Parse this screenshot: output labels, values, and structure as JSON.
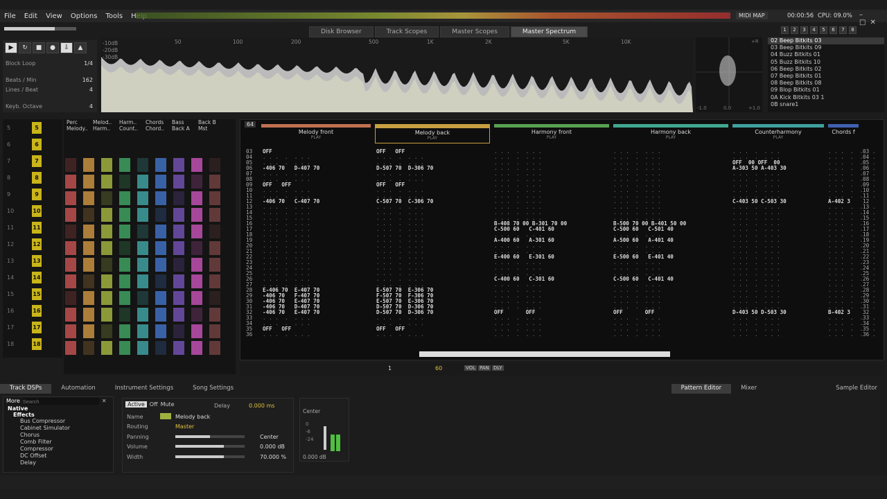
{
  "menu": [
    "File",
    "Edit",
    "View",
    "Options",
    "Tools",
    "Help"
  ],
  "status": {
    "midi_map": "MIDI MAP",
    "time": "00:00:56",
    "cpu": "CPU: 09.0%"
  },
  "top_tabs": [
    "Disk Browser",
    "Track Scopes",
    "Master Scopes",
    "Master Spectrum"
  ],
  "active_top_tab": "Master Spectrum",
  "transport": {
    "block_loop_label": "Block Loop",
    "block_loop_value": "1/4",
    "bpm_label": "Beats / Min",
    "bpm_value": "162",
    "lpb_label": "Lines / Beat",
    "lpb_value": "4",
    "octave_label": "Keyb. Octave",
    "octave_value": "4"
  },
  "spectrum": {
    "db_labels": [
      "-10dB",
      "-20dB",
      "-30dB"
    ],
    "freq_labels": [
      "50",
      "100",
      "200",
      "500",
      "1K",
      "2K",
      "5K",
      "10K"
    ],
    "fill_color": "#a7b33a"
  },
  "scope_labels": {
    "left": "-1.0",
    "mid": "0.0",
    "right": "+1.0",
    "l": "L",
    "r": "+R"
  },
  "instruments": [
    "02 Beep Bitkits 03",
    "03 Beep Bitkits 09",
    "04 Buzz Bitkits 01",
    "05 Buzz Bitkits 10",
    "06 Beep Bitkits 02",
    "07 Beep Bitkits 01",
    "08 Beep Bitkits 08",
    "09 Blop Bitkits 01",
    "0A Kick Bitkits 03 1",
    "0B snare1"
  ],
  "selected_instrument": 0,
  "seq_numbers": [
    "5",
    "6",
    "7",
    "8",
    "9",
    "10",
    "11",
    "12",
    "13",
    "14",
    "15",
    "16",
    "17",
    "18"
  ],
  "mixer_tracks": [
    "Perc",
    "Melod..",
    "Harm..",
    "Chords",
    "Bass",
    "Back B",
    "Melody..",
    "Harm..",
    "Count..",
    "Chord..",
    "Back A",
    "Mst"
  ],
  "pattern_number": "64",
  "track_headers": [
    {
      "name": "Melody front",
      "color": "#c07050"
    },
    {
      "name": "Melody back",
      "color": "#c8a040"
    },
    {
      "name": "Harmony front",
      "color": "#58a050"
    },
    {
      "name": "Harmony back",
      "color": "#40a890"
    },
    {
      "name": "Counterharmony",
      "color": "#40a0a0"
    },
    {
      "name": "Chords f",
      "color": "#4060b0"
    }
  ],
  "play_label": "PLAY",
  "line_numbers": [
    "03",
    "04",
    "05",
    "06",
    "07",
    "08",
    "09",
    "10",
    "11",
    "12",
    "13",
    "14",
    "15",
    "16",
    "17",
    "18",
    "19",
    "20",
    "21",
    "22",
    "23",
    "24",
    "25",
    "26",
    "27",
    "28",
    "29",
    "30",
    "31",
    "32",
    "33",
    "34",
    "35",
    "36"
  ],
  "col1": [
    "OFF",
    "",
    "",
    "-406 70   D-407 70",
    "",
    "",
    "OFF   OFF",
    "",
    "",
    "-406 70   C-407 70",
    "",
    "",
    "",
    "",
    "",
    "",
    "",
    "",
    "",
    "",
    "",
    "",
    "",
    "",
    "",
    "E-406 70  E-407 70",
    "-406 70   F-407 70",
    "-406 70   E-407 70",
    "-406 70   D-407 70",
    "-406 70   E-407 70",
    "",
    "",
    "OFF   OFF",
    ""
  ],
  "col2": [
    "OFF   OFF",
    "",
    "",
    "D-507 70  D-306 70",
    "",
    "",
    "OFF   OFF",
    "",
    "",
    "C-507 70  C-306 70",
    "",
    "",
    "",
    "",
    "",
    "",
    "",
    "",
    "",
    "",
    "",
    "",
    "",
    "",
    "",
    "E-507 70  E-306 70",
    "F-507 70  F-306 70",
    "E-507 70  E-306 70",
    "D-507 70  D-306 70",
    "D-507 70  D-306 70",
    "",
    "",
    "OFF   OFF",
    ""
  ],
  "col3": [
    "",
    "",
    "",
    "",
    "",
    "",
    "",
    "",
    "",
    "",
    "",
    "",
    "",
    "B-408 70 00 B-301 70 00",
    "C-500 60   C-401 60",
    "",
    "A-400 60   A-301 60",
    "",
    "",
    "E-400 60   E-301 60",
    "",
    "",
    "",
    "C-400 60   C-301 60",
    "",
    "",
    "",
    "",
    "",
    "OFF       OFF",
    "",
    "",
    "",
    ""
  ],
  "col4": [
    "",
    "",
    "",
    "",
    "",
    "",
    "",
    "",
    "",
    "",
    "",
    "",
    "",
    "B-500 70 00 B-401 50 00",
    "C-500 60   C-501 40",
    "",
    "A-500 60   A-401 40",
    "",
    "",
    "E-500 60   E-401 40",
    "",
    "",
    "",
    "C-500 60   C-401 40",
    "",
    "",
    "",
    "",
    "",
    "OFF       OFF",
    "",
    "",
    "",
    ""
  ],
  "col5": [
    "",
    "",
    "OFF  00 OFF  00",
    "A-303 50 A-403 30",
    "",
    "",
    "",
    "",
    "",
    "C-403 50 C-503 30",
    "",
    "",
    "",
    "",
    "",
    "",
    "",
    "",
    "",
    "",
    "",
    "",
    "",
    "",
    "",
    "",
    "",
    "",
    "",
    "D-403 50 D-503 30",
    "",
    "",
    "",
    ""
  ],
  "col6": [
    "",
    "",
    "",
    "",
    "",
    "",
    "",
    "",
    "",
    "A-402 3",
    "",
    "",
    "",
    "",
    "",
    "",
    "",
    "",
    "",
    "",
    "",
    "",
    "",
    "",
    "",
    "",
    "",
    "",
    "",
    "B-402 3",
    "",
    "",
    "",
    ""
  ],
  "lower_bar": {
    "lines": "1",
    "step": "60",
    "vol": "VOL",
    "pan": "PAN",
    "dly": "DLY"
  },
  "lower_tabs_left": [
    "Track DSPs",
    "Automation",
    "Instrument Settings",
    "Song Settings"
  ],
  "lower_tabs_right": [
    "Pattern Editor",
    "Mixer",
    "Sample Editor"
  ],
  "active_lower_tab": "Pattern Editor",
  "dsp": {
    "more": "More",
    "search_placeholder": "Search",
    "group_native": "Native",
    "group_effects": "Effects",
    "items": [
      "Bus Compressor",
      "Cabinet Simulator",
      "Chorus",
      "Comb Filter",
      "Compressor",
      "DC Offset",
      "Delay"
    ]
  },
  "props": {
    "active": "Active",
    "off": "Off",
    "mute": "Mute",
    "delay_label": "Delay",
    "delay_value": "0.000 ms",
    "name_label": "Name",
    "name_value": "Melody back",
    "routing_label": "Routing",
    "routing_value": "Master",
    "panning_label": "Panning",
    "panning_value": "Center",
    "volume_label": "Volume",
    "volume_value": "0.000 dB",
    "width_label": "Width",
    "width_value": "70.000 %",
    "track_color": "#a0b040"
  },
  "vu": {
    "center": "Center",
    "scale": [
      "0",
      "-6",
      "-24"
    ],
    "db": "0.000 dB"
  }
}
